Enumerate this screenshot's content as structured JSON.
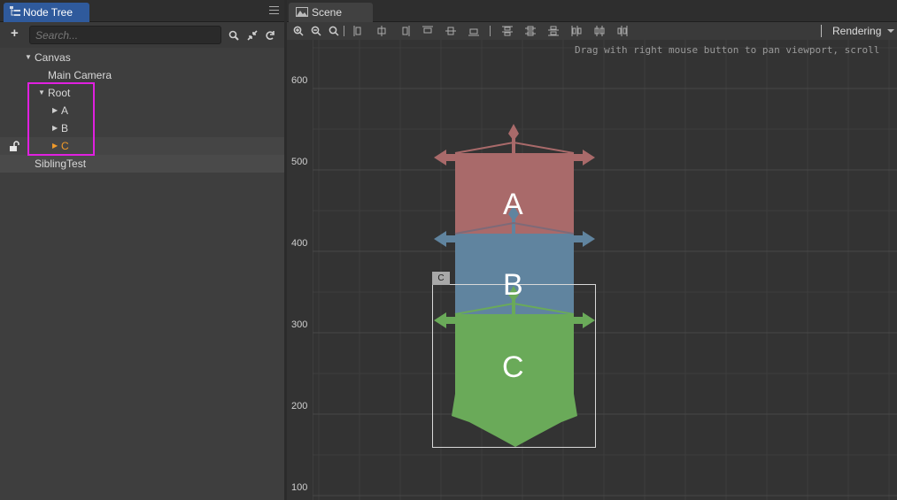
{
  "node_tree": {
    "tab_label": "Node Tree",
    "search_placeholder": "Search...",
    "nodes": {
      "canvas": "Canvas",
      "main_camera": "Main Camera",
      "root": "Root",
      "a": "A",
      "b": "B",
      "c": "C",
      "sibling_test": "SiblingTest"
    }
  },
  "scene": {
    "tab_label": "Scene",
    "rendering_label": "Rendering",
    "hint": "Drag with right mouse button to pan viewport, scroll",
    "ruler_labels": [
      "600",
      "500",
      "400",
      "300",
      "200",
      "100"
    ],
    "node_letters": {
      "a": "A",
      "b": "B",
      "c": "C"
    },
    "selection_tag": "C",
    "colors": {
      "node_a": "#a96a6a",
      "node_b": "#60849f",
      "node_c": "#6aaa59",
      "highlight": "#e020e0",
      "selected_node_text": "#f09a2a"
    }
  }
}
